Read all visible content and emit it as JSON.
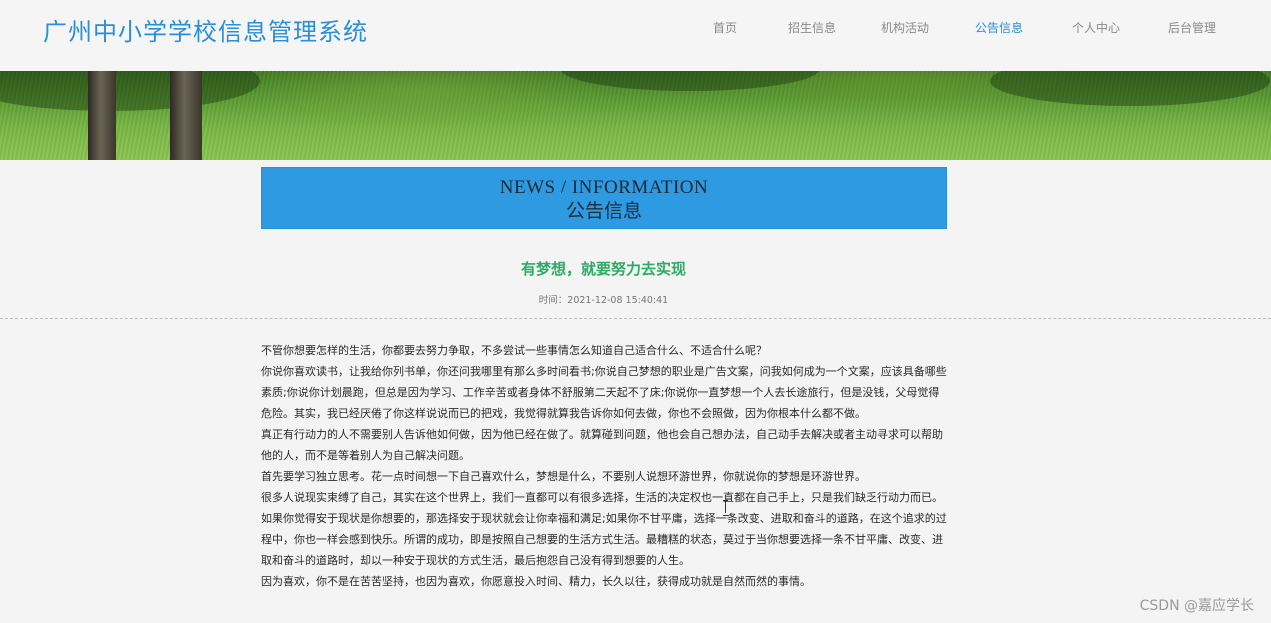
{
  "header": {
    "site_title": "广州中小学学校信息管理系统",
    "nav": [
      {
        "label": "首页"
      },
      {
        "label": "招生信息"
      },
      {
        "label": "机构活动"
      },
      {
        "label": "公告信息"
      },
      {
        "label": "个人中心"
      },
      {
        "label": "后台管理"
      }
    ],
    "active_nav": "公告信息"
  },
  "section": {
    "en": "NEWS / INFORMATION",
    "cn": "公告信息"
  },
  "article": {
    "title": "有梦想，就要努力去实现",
    "time": "时间：2021-12-08 15:40:41",
    "paragraphs": [
      "不管你想要怎样的生活，你都要去努力争取，不多尝试一些事情怎么知道自己适合什么、不适合什么呢？",
      "你说你喜欢读书，让我给你列书单，你还问我哪里有那么多时间看书;你说自己梦想的职业是广告文案，问我如何成为一个文案，应该具备哪些素质;你说你计划晨跑，但总是因为学习、工作辛苦或者身体不舒服第二天起不了床;你说你一直梦想一个人去长途旅行，但是没钱，父母觉得危险。其实，我已经厌倦了你这样说说而已的把戏，我觉得就算我告诉你如何去做，你也不会照做，因为你根本什么都不做。",
      "真正有行动力的人不需要别人告诉他如何做，因为他已经在做了。就算碰到问题，他也会自己想办法，自己动手去解决或者主动寻求可以帮助他的人，而不是等着别人为自己解决问题。",
      "首先要学习独立思考。花一点时间想一下自己喜欢什么，梦想是什么，不要别人说想环游世界，你就说你的梦想是环游世界。",
      "很多人说现实束缚了自己，其实在这个世界上，我们一直都可以有很多选择，生活的决定权也一直都在自己手上，只是我们缺乏行动力而已。",
      "如果你觉得安于现状是你想要的，那选择安于现状就会让你幸福和满足;如果你不甘平庸，选择一条改变、进取和奋斗的道路，在这个追求的过程中，你也一样会感到快乐。所谓的成功，即是按照自己想要的生活方式生活。最糟糕的状态，莫过于当你想要选择一条不甘平庸、改变、进取和奋斗的道路时，却以一种安于现状的方式生活，最后抱怨自己没有得到想要的人生。",
      "因为喜欢，你不是在苦苦坚持，也因为喜欢，你愿意投入时间、精力，长久以往，获得成功就是自然而然的事情。"
    ]
  },
  "watermark": "CSDN @嘉应学长"
}
